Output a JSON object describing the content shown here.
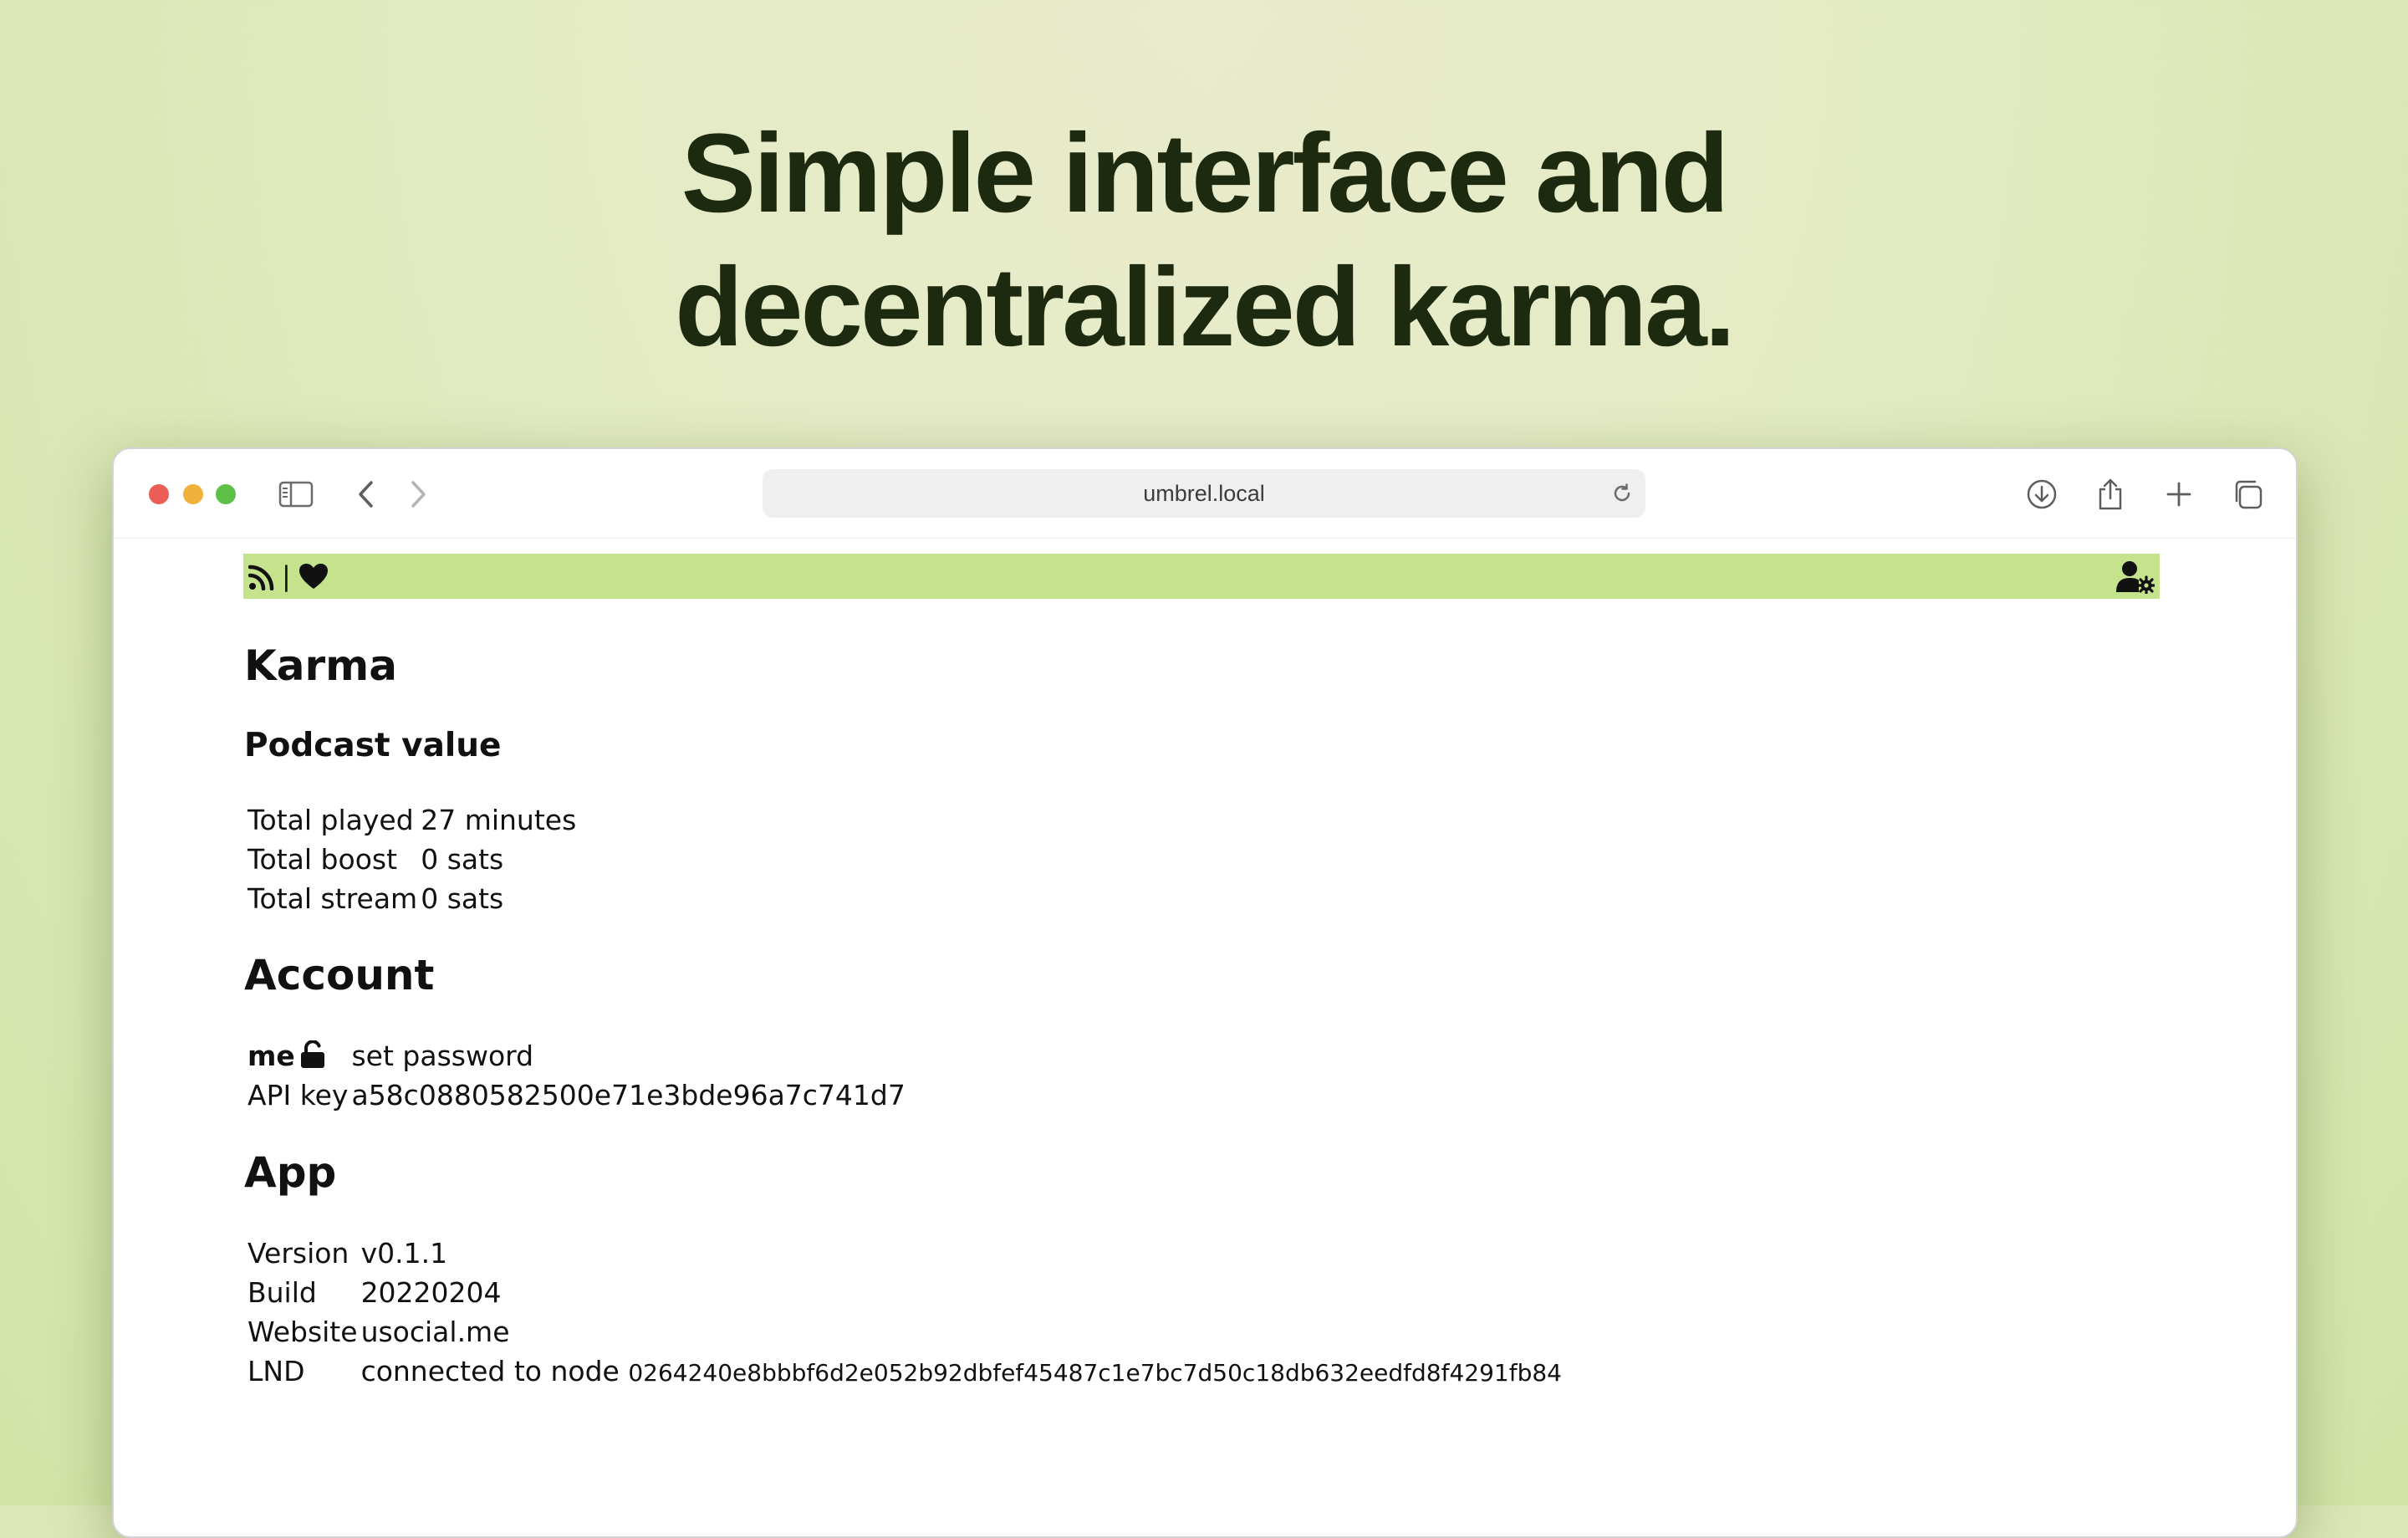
{
  "headline": {
    "line1": "Simple interface and",
    "line2": "decentralized karma."
  },
  "browser": {
    "url": "umbrel.local"
  },
  "icons": {
    "feed": "rss-icon",
    "separator": "|",
    "heart": "heart-icon",
    "user_settings": "user-cog-icon",
    "lock": "unlock-icon"
  },
  "colors": {
    "nav_bar": "#c5e38d",
    "background": "#e3ebc4",
    "headline": "#1e2a10"
  },
  "page": {
    "karma_title": "Karma",
    "podcast_title": "Podcast value",
    "podcast_rows": [
      {
        "label": "Total played",
        "value": "27 minutes"
      },
      {
        "label": "Total boost",
        "value": "0 sats"
      },
      {
        "label": "Total stream",
        "value": "0 sats"
      }
    ],
    "account_title": "Account",
    "account": {
      "user": "me",
      "set_password": "set password",
      "api_key_label": "API key",
      "api_key_value": "a58c0880582500e71e3bde96a7c741d7"
    },
    "app_title": "App",
    "app_rows": {
      "version_label": "Version",
      "version_value": "v0.1.1",
      "build_label": "Build",
      "build_value": "20220204",
      "website_label": "Website",
      "website_value": "usocial.me",
      "lnd_label": "LND",
      "lnd_value": "connected to node",
      "lnd_node": "0264240e8bbbf6d2e052b92dbfef45487c1e7bc7d50c18db632eedfd8f4291fb84"
    }
  }
}
